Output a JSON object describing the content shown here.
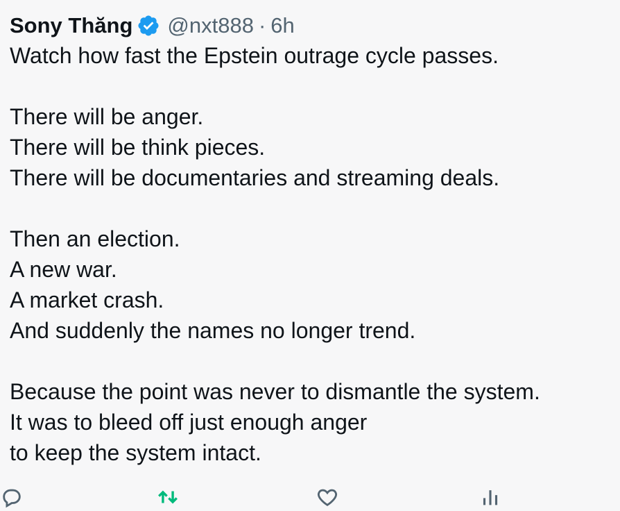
{
  "tweet": {
    "author_name": "Sony Thăng",
    "handle": "@nxt888",
    "separator": "·",
    "time": "6h",
    "lines": [
      "Watch how fast the Epstein outrage cycle passes.",
      "",
      "There will be anger.",
      "There will be think pieces.",
      "There will be documentaries and streaming deals.",
      "",
      "Then an election.",
      "A new war.",
      "A market crash.",
      "And suddenly the names no longer trend.",
      "",
      "Because the point was never to dismantle the system.",
      "It was to bleed off just enough anger",
      "to keep the system intact."
    ]
  },
  "actions": {
    "reply_count": "",
    "repost_count": "",
    "like_count": "",
    "views_count": ""
  },
  "icons": {
    "verified": "verified-badge-icon",
    "reply": "reply-icon",
    "repost": "repost-icon",
    "like": "heart-icon",
    "views": "views-icon"
  },
  "colors": {
    "verified_blue": "#1d9bf0",
    "repost_green": "#00ba7c",
    "secondary_text": "#536471",
    "primary_text": "#0f1419",
    "background": "#f7f7f8"
  }
}
